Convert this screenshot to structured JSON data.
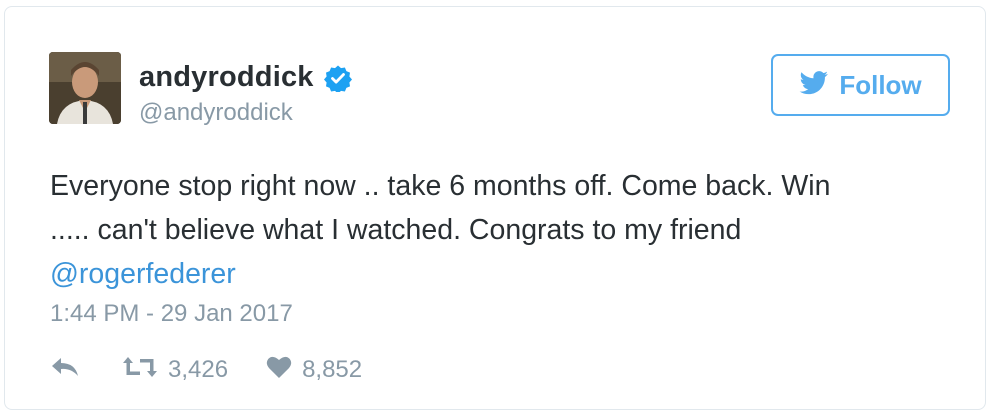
{
  "tweet": {
    "display_name": "andyroddick",
    "handle": "@andyroddick",
    "text_lines": [
      "Everyone stop right now .. take 6 months off. Come back. Win",
      "..... can't believe what I watched. Congrats to my friend"
    ],
    "mention": "@rogerfederer",
    "timestamp": "1:44 PM - 29 Jan 2017",
    "retweet_count": "3,426",
    "like_count": "8,852"
  },
  "follow_button": {
    "label": "Follow"
  },
  "icons": {
    "avatar": "profile-photo",
    "verified": "verified-badge-icon",
    "follow": "twitter-bird-icon",
    "reply": "reply-icon",
    "retweet": "retweet-icon",
    "like": "heart-icon"
  },
  "colors": {
    "brand_blue": "#55acee",
    "link_blue": "#3b94d9",
    "text": "#292f33",
    "muted": "#8899a6"
  }
}
